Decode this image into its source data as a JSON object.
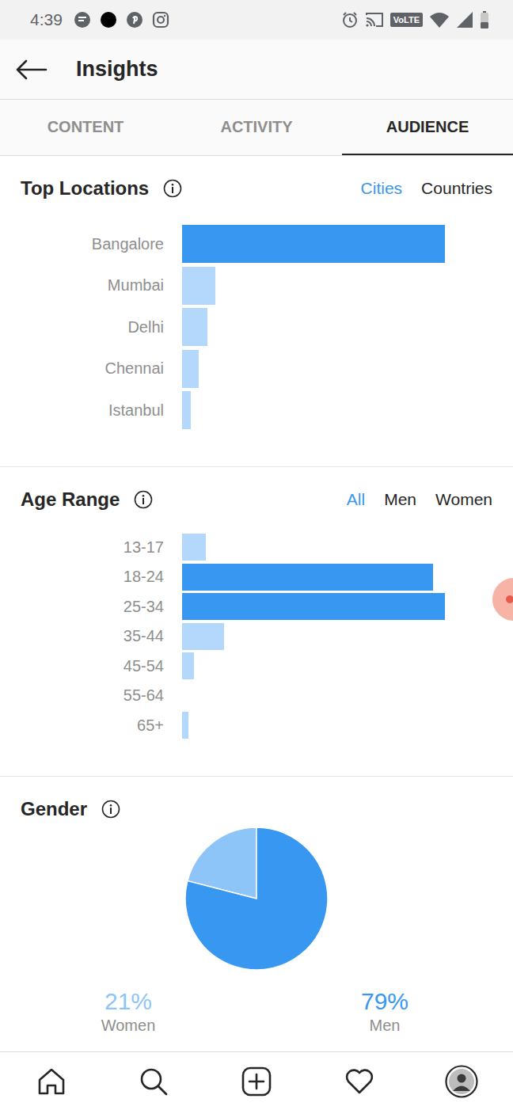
{
  "status_bar": {
    "time": "4:39",
    "network": "VoLTE"
  },
  "header": {
    "title": "Insights"
  },
  "tabs": [
    {
      "label": "CONTENT",
      "selected": false
    },
    {
      "label": "ACTIVITY",
      "selected": false
    },
    {
      "label": "AUDIENCE",
      "selected": true
    }
  ],
  "top_locations": {
    "title": "Top Locations",
    "toggles": [
      {
        "label": "Cities",
        "selected": true
      },
      {
        "label": "Countries",
        "selected": false
      }
    ],
    "bars": [
      {
        "label": "Bangalore",
        "value": 100,
        "highlighted": true
      },
      {
        "label": "Mumbai",
        "value": 12.7,
        "highlighted": false
      },
      {
        "label": "Delhi",
        "value": 9.6,
        "highlighted": false
      },
      {
        "label": "Chennai",
        "value": 6.3,
        "highlighted": false
      },
      {
        "label": "Istanbul",
        "value": 3.3,
        "highlighted": false
      }
    ]
  },
  "age_range": {
    "title": "Age Range",
    "toggles": [
      {
        "label": "All",
        "selected": true
      },
      {
        "label": "Men",
        "selected": false
      },
      {
        "label": "Women",
        "selected": false
      }
    ],
    "bars": [
      {
        "label": "13-17",
        "value": 9,
        "highlighted": false
      },
      {
        "label": "18-24",
        "value": 95.5,
        "highlighted": true
      },
      {
        "label": "25-34",
        "value": 100,
        "highlighted": true
      },
      {
        "label": "35-44",
        "value": 16,
        "highlighted": false
      },
      {
        "label": "45-54",
        "value": 4.5,
        "highlighted": false
      },
      {
        "label": "55-64",
        "value": 0,
        "highlighted": false
      },
      {
        "label": "65+",
        "value": 2.4,
        "highlighted": false
      }
    ]
  },
  "gender": {
    "title": "Gender",
    "slices": [
      {
        "label": "Women",
        "percent": "21%",
        "value": 21,
        "color": "#8ec5f9"
      },
      {
        "label": "Men",
        "percent": "79%",
        "value": 79,
        "color": "#3897f0"
      }
    ]
  }
}
